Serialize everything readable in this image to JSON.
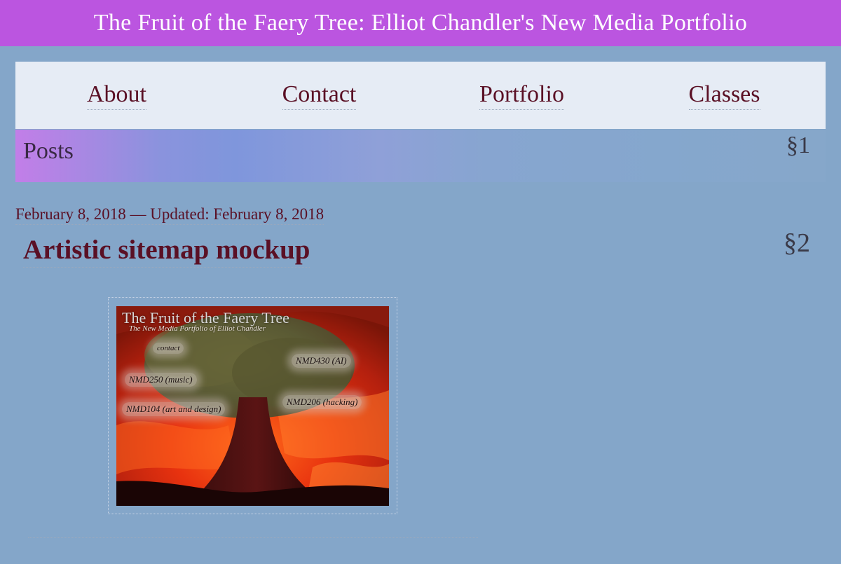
{
  "header": {
    "site_title": "The Fruit of the Faery Tree: Elliot Chandler's New Media Portfolio"
  },
  "nav": {
    "items": [
      {
        "label": "About"
      },
      {
        "label": "Contact"
      },
      {
        "label": "Portfolio"
      },
      {
        "label": "Classes"
      }
    ]
  },
  "posts_section": {
    "title": "Posts",
    "section_mark": "§1"
  },
  "post": {
    "date_line": "February 8, 2018 — Updated: February 8, 2018",
    "title": "Artistic sitemap mockup",
    "section_mark": "§2",
    "image": {
      "title": "The Fruit of the Faery Tree",
      "subtitle": "The New Media Portfolio of Elliot Chandler",
      "labels": {
        "contact": "contact",
        "nmd430": "NMD430 (AI)",
        "nmd250": "NMD250 (music)",
        "nmd206": "NMD206 (hacking)",
        "nmd104": "NMD104 (art and design)"
      }
    }
  },
  "colors": {
    "page_background": "#84a6c9",
    "header_background": "#bb55e0",
    "nav_background": "#e6ecf5",
    "link_color": "#5a1025"
  }
}
